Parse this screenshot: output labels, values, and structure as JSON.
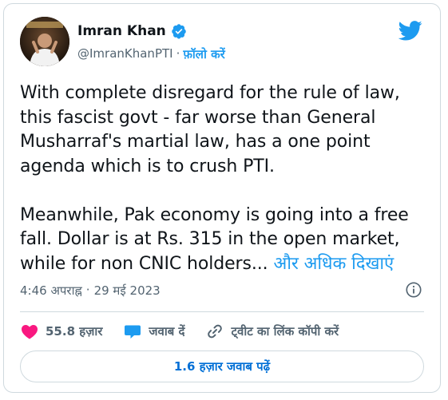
{
  "author": {
    "name": "Imran Khan",
    "handle": "@ImranKhanPTI",
    "separator": "·",
    "follow_label": "फ़ॉलो करें",
    "verified_icon": "verified-badge-icon"
  },
  "brand": {
    "logo": "twitter-bird-icon",
    "accent": "#1d9bf0"
  },
  "tweet": {
    "text": "With complete disregard for the rule of law, this fascist govt - far worse than General Musharraf's martial law, has a one point agenda which is to crush PTI.\n\nMeanwhile, Pak economy is going into a free fall. Dollar is at Rs. 315 in the open market, while for non CNIC holders... ",
    "more_label": "और अधिक दिखाएं",
    "time": "4:46 अपराह्न",
    "dot": "·",
    "date": "29 मई 2023"
  },
  "actions": {
    "like_count": "55.8 हज़ार",
    "reply_label": "जवाब दें",
    "copy_link_label": "ट्वीट का लिंक कॉपी करें"
  },
  "replies_button": {
    "label": "1.6 हज़ार जवाब पढ़ें"
  },
  "colors": {
    "like": "#f91880",
    "reply": "#1d9bf0",
    "text": "#0f1419",
    "muted": "#536471"
  }
}
